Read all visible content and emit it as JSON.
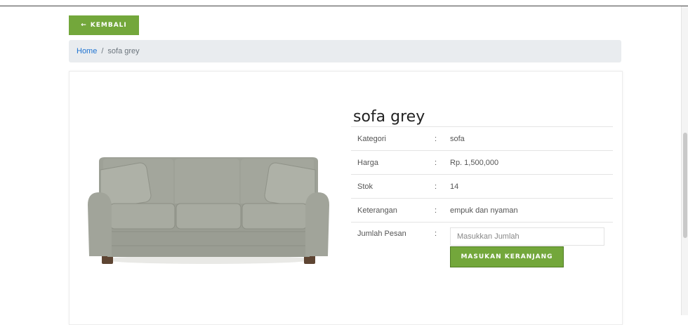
{
  "nav": {
    "back_label": "KEMBALI",
    "back_icon": "arrow-left-icon"
  },
  "breadcrumb": {
    "home": "Home",
    "separator": "/",
    "current": "sofa grey"
  },
  "product": {
    "name": "sofa grey",
    "image_icon": "sofa-image",
    "details": [
      {
        "label": "Kategori",
        "sep": ":",
        "value": "sofa"
      },
      {
        "label": "Harga",
        "sep": ":",
        "value": "Rp. 1,500,000"
      },
      {
        "label": "Stok",
        "sep": ":",
        "value": "14"
      },
      {
        "label": "Keterangan",
        "sep": ":",
        "value": "empuk dan nyaman"
      }
    ],
    "quantity": {
      "label": "Jumlah Pesan",
      "sep": ":",
      "placeholder": "Masukkan Jumlah",
      "value": ""
    },
    "cart_button": "MASUKAN KERANJANG"
  },
  "colors": {
    "accent": "#73a73b",
    "link": "#1f73d1",
    "breadcrumb_bg": "#e9ecef"
  }
}
